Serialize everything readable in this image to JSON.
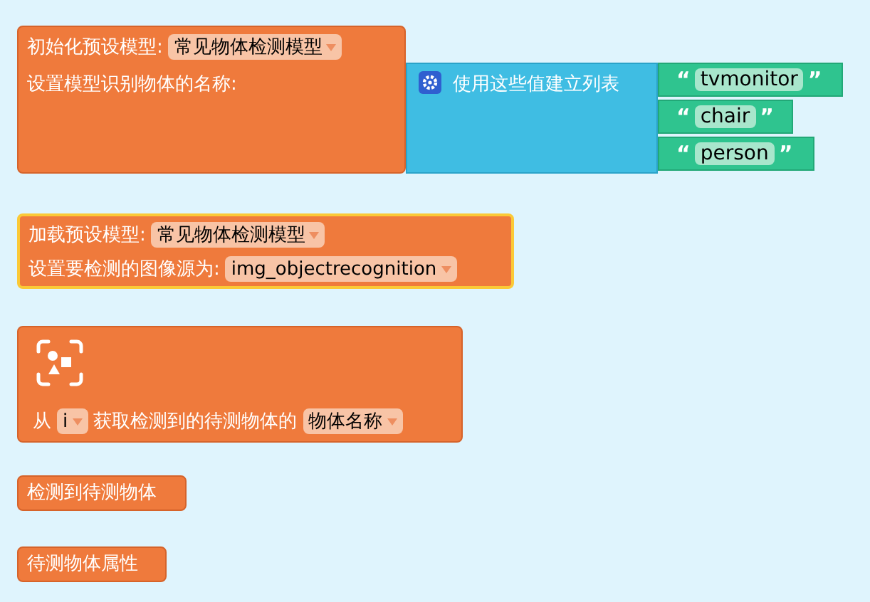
{
  "workspace": {
    "blocks": [
      {
        "kind": "init_model",
        "label": "初始化预设模型:",
        "model": "常见物体检测模型",
        "names_label": "设置模型识别物体的名称:",
        "selected": false,
        "list": {
          "label": "使用这些值建立列表",
          "items": [
            {
              "open": "“",
              "text": "tvmonitor",
              "close": "”"
            },
            {
              "open": "“",
              "text": "chair",
              "close": "”"
            },
            {
              "open": "“",
              "text": "person",
              "close": "”"
            }
          ]
        }
      },
      {
        "kind": "load_model",
        "label": "加载预设模型:",
        "model": "常见物体检测模型",
        "source_label": "设置要检测的图像源为:",
        "source": "img_objectrecognition",
        "selected": true
      },
      {
        "kind": "get_property",
        "prefix": "从",
        "variable": "i",
        "text": "获取检测到的待测物体的",
        "property": "物体名称",
        "selected": false
      },
      {
        "kind": "value",
        "label": "检测到待测物体",
        "selected": false
      },
      {
        "kind": "value",
        "label": "待测物体属性",
        "selected": false
      }
    ]
  }
}
